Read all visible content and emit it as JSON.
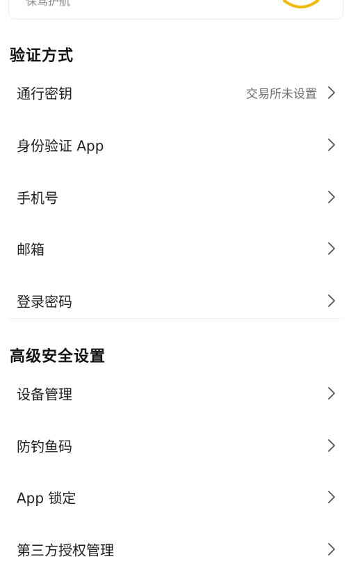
{
  "top_card": {
    "text": "保驾护航"
  },
  "sections": [
    {
      "title": "验证方式",
      "items": [
        {
          "label": "通行密钥",
          "status": "交易所未设置"
        },
        {
          "label": "身份验证 App"
        },
        {
          "label": "手机号"
        },
        {
          "label": "邮箱"
        },
        {
          "label": "登录密码"
        }
      ]
    },
    {
      "title": "高级安全设置",
      "items": [
        {
          "label": "设备管理"
        },
        {
          "label": "防钓鱼码"
        },
        {
          "label": "App 锁定"
        },
        {
          "label": "第三方授权管理"
        }
      ]
    }
  ],
  "icons": {
    "chevron": "chevron-right-icon",
    "card_illustration": "shield-badge-illustration"
  },
  "colors": {
    "accent": "#f0b90b",
    "text_primary": "#1e1e1e",
    "text_secondary": "#6f6f6f",
    "chevron": "#555555"
  }
}
